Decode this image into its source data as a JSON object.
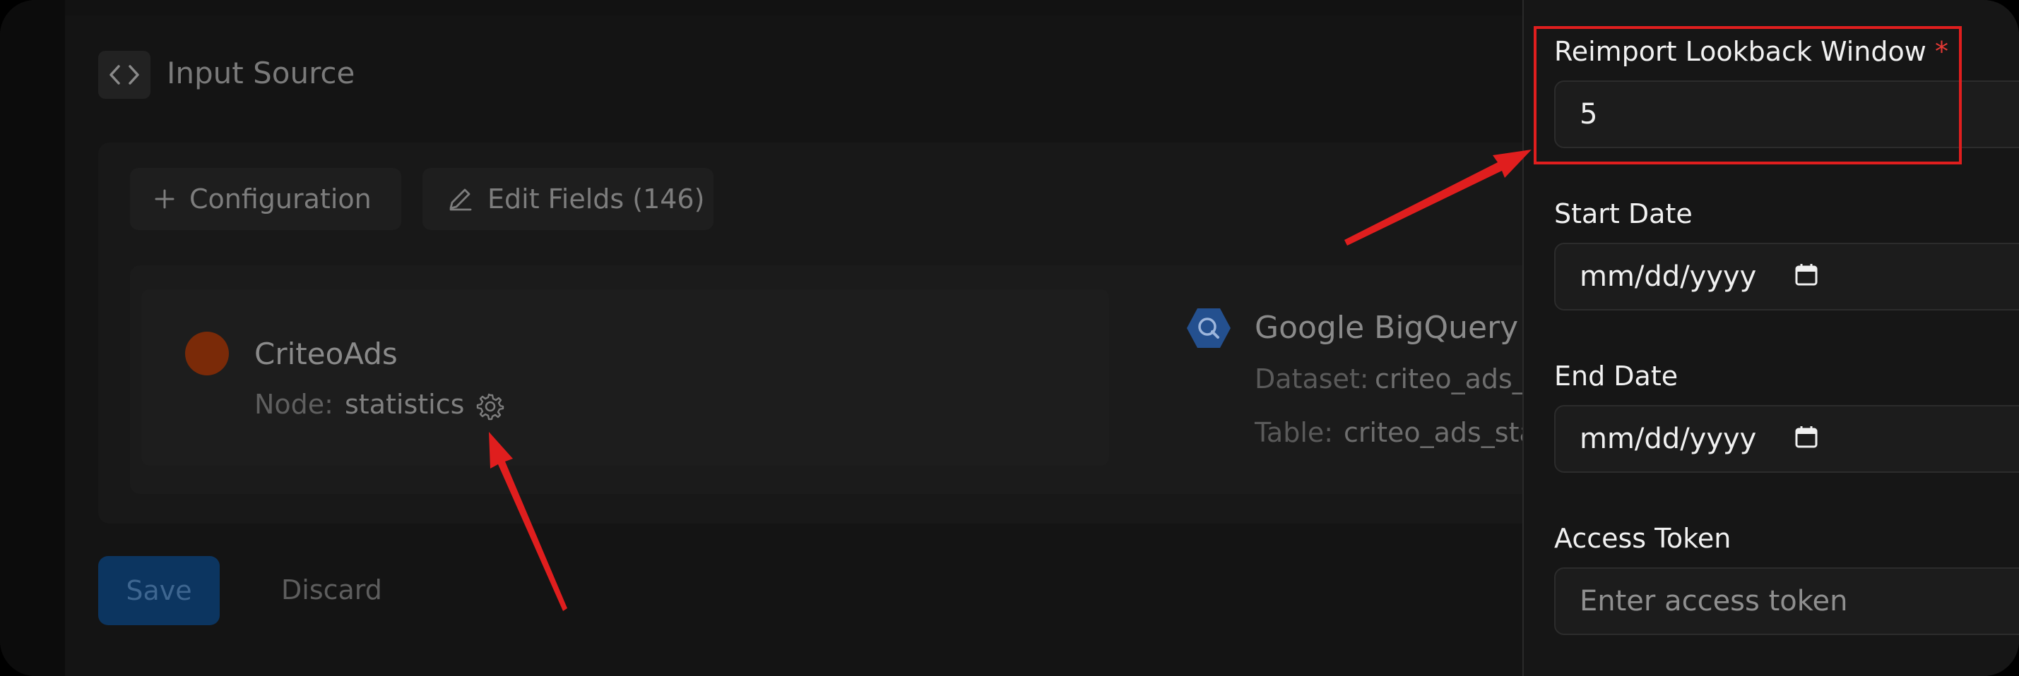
{
  "header": {
    "title": "Input Source",
    "icon": "code-icon"
  },
  "toolbar": {
    "configuration_label": "Configuration",
    "edit_fields_label": "Edit Fields (146)"
  },
  "source": {
    "name": "CriteoAds",
    "node_label": "Node:",
    "node_value": "statistics",
    "dot_color": "#7a2a08"
  },
  "destination": {
    "name": "Google BigQuery",
    "dataset_label": "Dataset:",
    "dataset_value": "criteo_ads_c",
    "table_label": "Table:",
    "table_value": "criteo_ads_sta"
  },
  "actions": {
    "save_label": "Save",
    "discard_label": "Discard"
  },
  "drawer": {
    "reimport": {
      "label": "Reimport Lookback Window",
      "required_marker": "*",
      "value": "5"
    },
    "start_date": {
      "label": "Start Date",
      "placeholder": "mm/dd/yyyy"
    },
    "end_date": {
      "label": "End Date",
      "placeholder": "mm/dd/yyyy"
    },
    "access_token": {
      "label": "Access Token",
      "placeholder": "Enter access token"
    }
  },
  "annotations": {
    "color": "#e01e1e"
  }
}
